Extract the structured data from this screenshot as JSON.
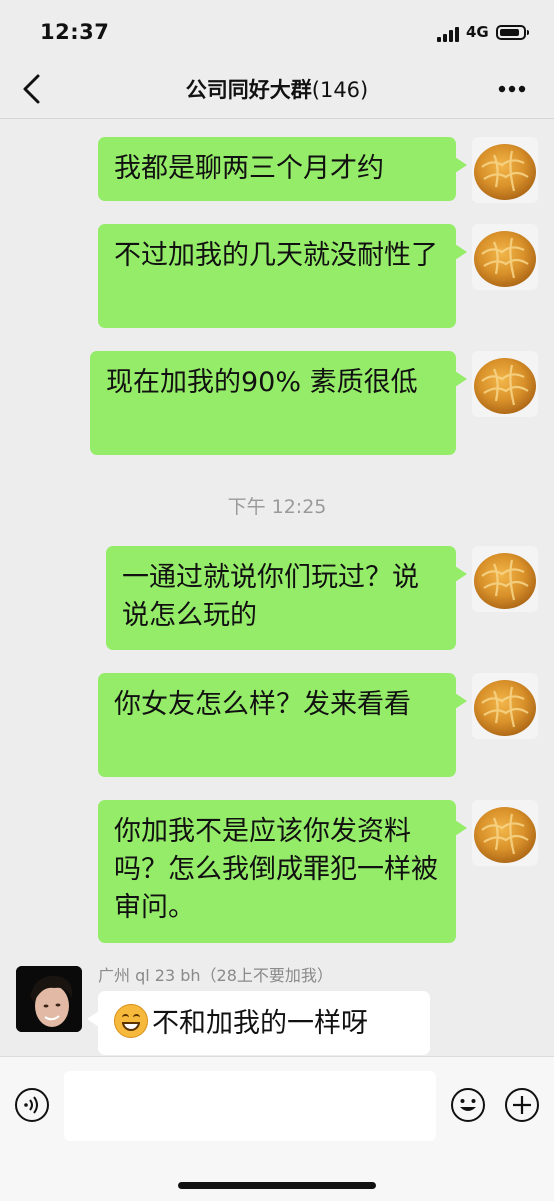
{
  "status_bar": {
    "time": "12:37",
    "network": "4G"
  },
  "header": {
    "title": "公司同好大群",
    "member_count": "(146)"
  },
  "messages": [
    {
      "text": "我都是聊两三个月才约"
    },
    {
      "text": "不过加我的几天就没耐性了"
    },
    {
      "text": "现在加我的90% 素质很低"
    },
    {
      "text": "一通过就说你们玩过？说说怎么玩的"
    },
    {
      "text": "你女友怎么样？发来看看"
    },
    {
      "text": "你加我不是应该你发资料吗？怎么我倒成罪犯一样被审问。"
    }
  ],
  "timestamp": "下午 12:25",
  "other_message": {
    "sender": "广州 ql 23 bh（28上不要加我）",
    "text": "不和加我的一样呀",
    "emoji": "grinning-face-emoji"
  },
  "icons": {
    "back": "back-chevron-icon",
    "more": "more-dots-icon",
    "voice": "voice-icon",
    "emoji": "emoji-icon",
    "plus": "plus-icon"
  },
  "colors": {
    "bubble_self": "#95ec69",
    "bubble_other": "#ffffff",
    "background": "#ededed"
  }
}
